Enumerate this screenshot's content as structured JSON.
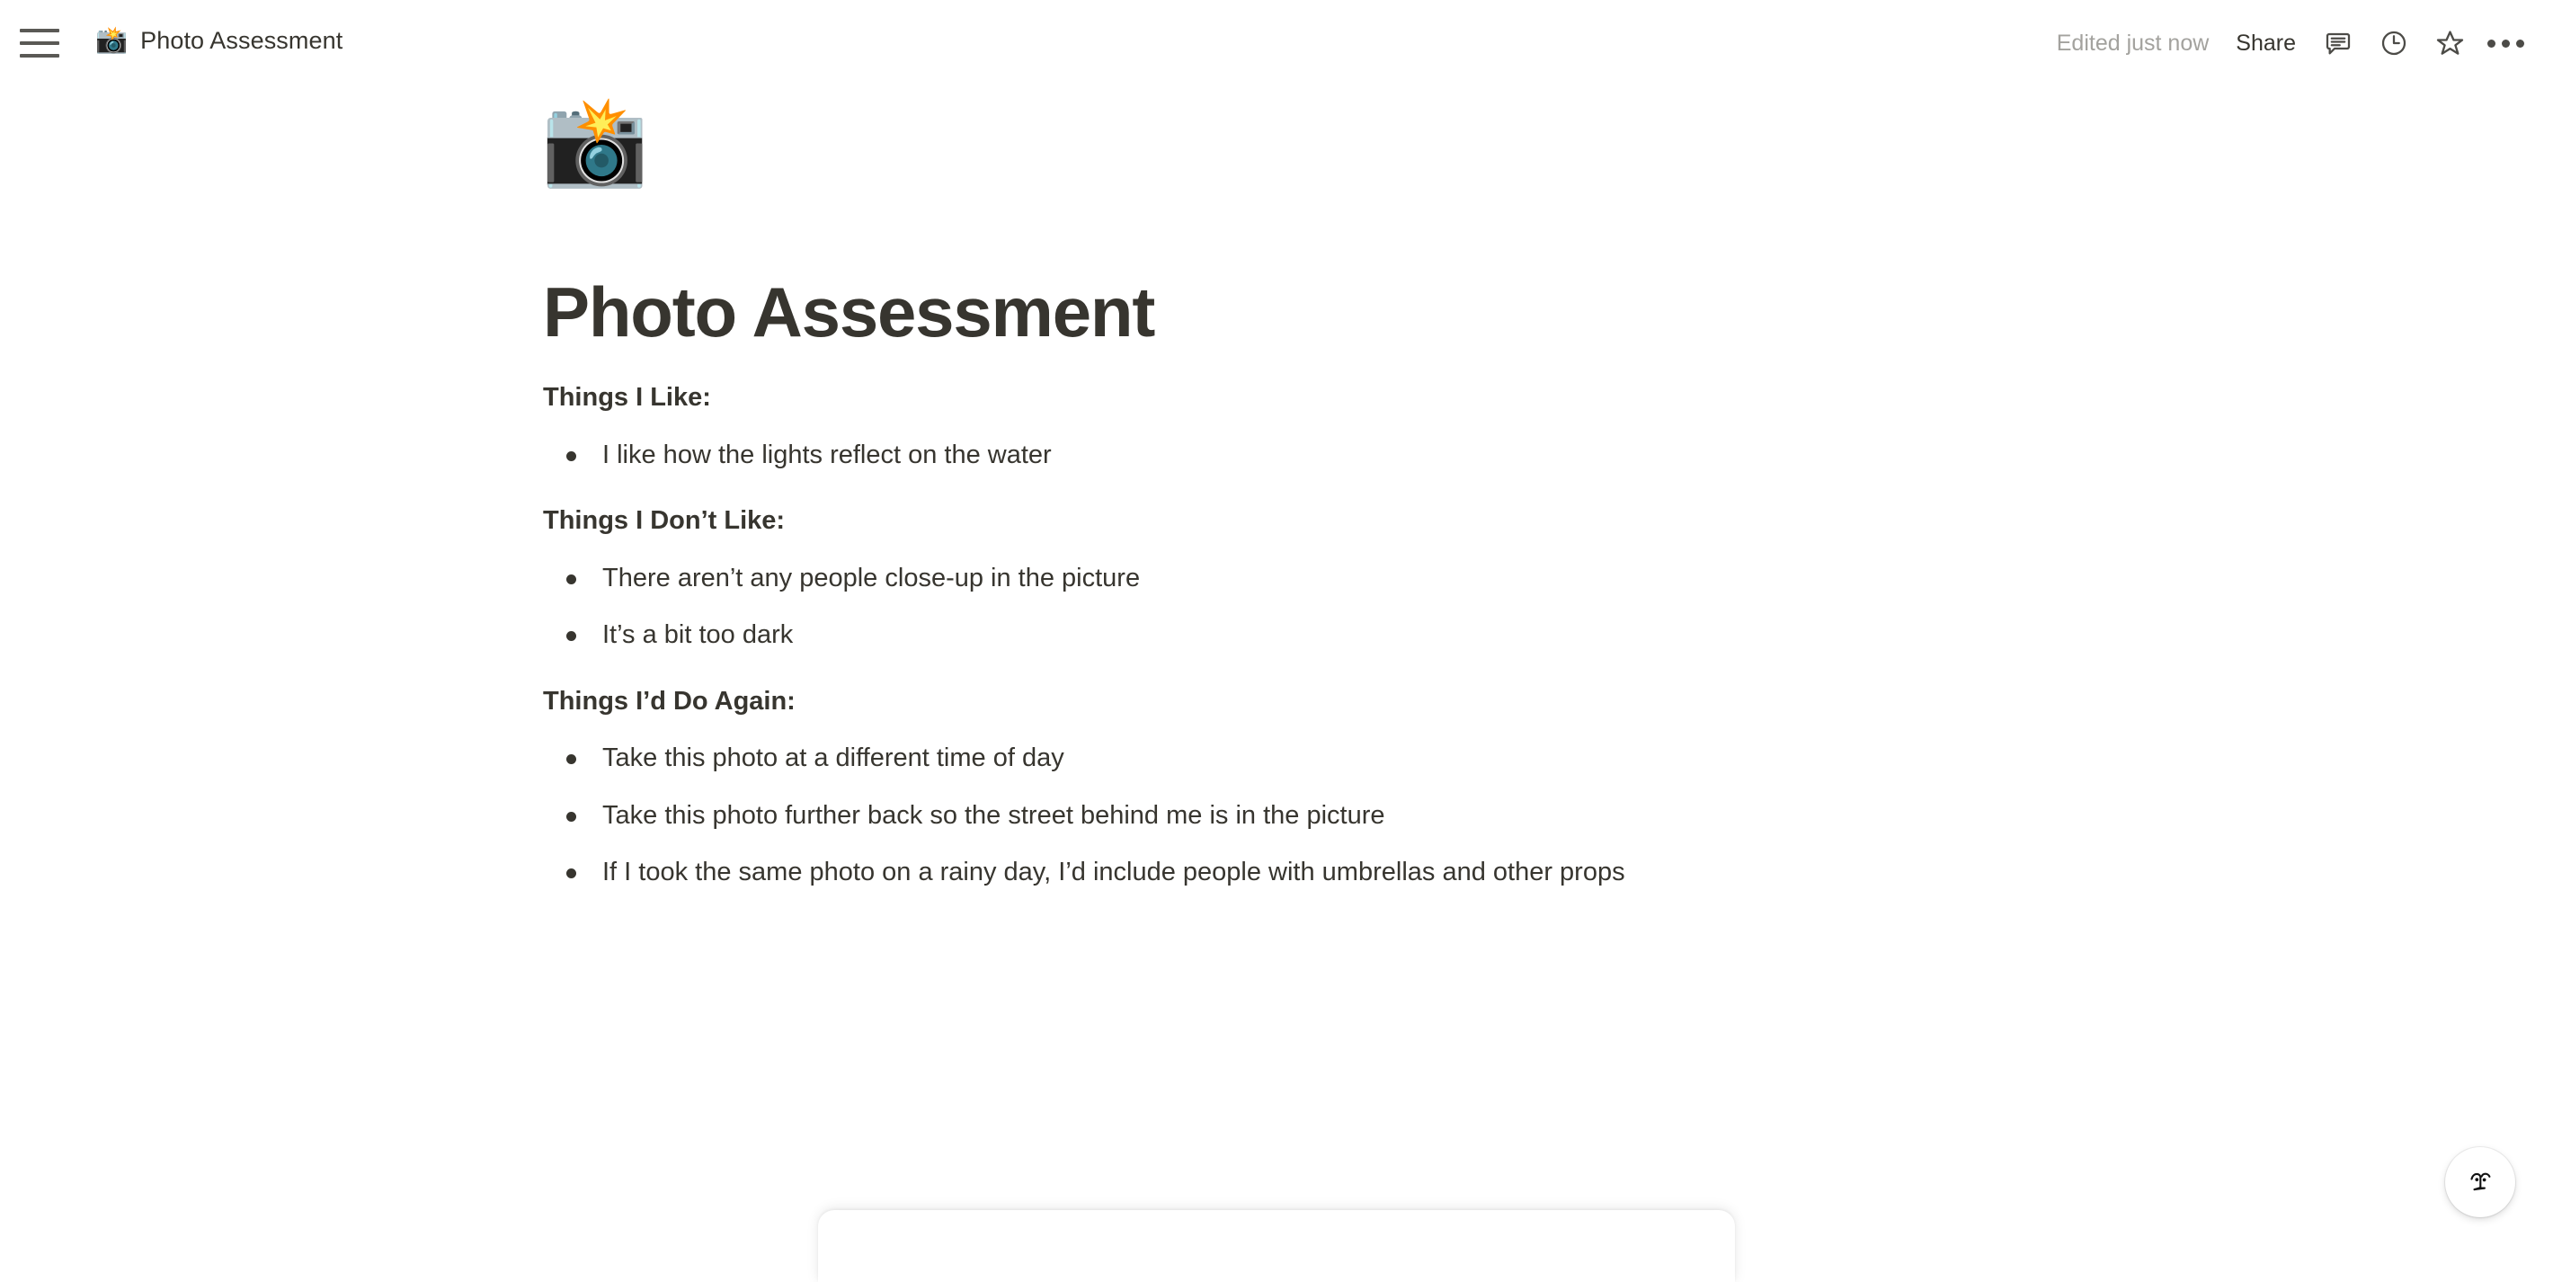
{
  "topbar": {
    "menu_icon": "hamburger-menu-icon",
    "breadcrumb_emoji": "📸",
    "breadcrumb_title": "Photo Assessment",
    "edited_status": "Edited just now",
    "share_label": "Share",
    "icons": [
      {
        "name": "comment-icon",
        "label": "Comments"
      },
      {
        "name": "clock-icon",
        "label": "Page history"
      },
      {
        "name": "star-icon",
        "label": "Add to favorites"
      },
      {
        "name": "more-options-icon",
        "label": "More options"
      }
    ]
  },
  "document": {
    "emoji": "📸",
    "title": "Photo Assessment",
    "sections": [
      {
        "heading": "Things I Like:",
        "items": [
          "I like how the lights reflect on the water"
        ]
      },
      {
        "heading": "Things I Don’t Like:",
        "items": [
          "There aren’t any people close-up in the picture",
          "It’s a bit too dark"
        ]
      },
      {
        "heading": "Things I’d Do Again:",
        "items": [
          "Take this photo at a different time of day",
          "Take this photo further back so the street behind me is in the picture",
          "If I took the same photo on a rainy day, I’d include people with umbrellas and other props"
        ]
      }
    ]
  },
  "floating": {
    "ai_button_icon": "ai-face-icon"
  },
  "colors": {
    "text": "#37352f",
    "muted": "#a3a29e",
    "icon": "#4c4b47",
    "background": "#ffffff"
  }
}
